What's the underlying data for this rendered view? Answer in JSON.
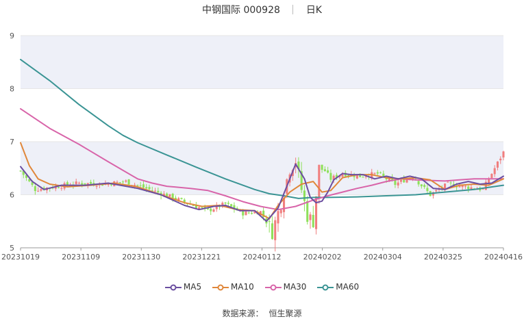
{
  "header": {
    "stock_name": "中钢国际",
    "stock_code": "000928",
    "period": "日K"
  },
  "footer": {
    "source_label": "数据来源：",
    "source_name": "恒生聚源"
  },
  "colors": {
    "up": "#f07e7e",
    "down": "#8fe05b",
    "ma5": "#6b4ea0",
    "ma10": "#e0873a",
    "ma30": "#d864a9",
    "ma60": "#3a9494",
    "band": "#eef0f8"
  },
  "chart_data": {
    "type": "candlestick",
    "ylim": [
      5,
      9
    ],
    "y_ticks": [
      5,
      6,
      7,
      8,
      9
    ],
    "x_ticks": [
      "20231019",
      "20231109",
      "20231130",
      "20231221",
      "20240112",
      "20240202",
      "20240304",
      "20240325",
      "20240416"
    ],
    "legend": [
      "MA5",
      "MA10",
      "MA30",
      "MA60"
    ],
    "legend_position": "bottom",
    "ma_series": [
      {
        "name": "MA5",
        "x": [
          0,
          4,
          8,
          14,
          22,
          30,
          40,
          48,
          56,
          61,
          66,
          70,
          75,
          80,
          84,
          88,
          92,
          94,
          97,
          99,
          101,
          103,
          105,
          107,
          110,
          113,
          117,
          121,
          125,
          129,
          133,
          137,
          141,
          145,
          149,
          153,
          157,
          161,
          165
        ],
        "values": [
          6.53,
          6.25,
          6.1,
          6.18,
          6.18,
          6.22,
          6.12,
          6.0,
          5.8,
          5.72,
          5.78,
          5.8,
          5.7,
          5.7,
          5.5,
          5.75,
          6.3,
          6.58,
          6.3,
          5.95,
          5.85,
          5.88,
          6.05,
          6.28,
          6.4,
          6.38,
          6.38,
          6.3,
          6.35,
          6.3,
          6.35,
          6.3,
          6.12,
          6.1,
          6.2,
          6.25,
          6.2,
          6.22,
          6.35
        ]
      },
      {
        "name": "MA10",
        "x": [
          0,
          3,
          6,
          10,
          16,
          24,
          32,
          40,
          48,
          56,
          62,
          68,
          74,
          80,
          85,
          88,
          92,
          96,
          100,
          103,
          106,
          110,
          115,
          120,
          125,
          130,
          135,
          140,
          145,
          150,
          155,
          160,
          165
        ],
        "values": [
          6.98,
          6.55,
          6.3,
          6.2,
          6.15,
          6.18,
          6.22,
          6.15,
          6.0,
          5.85,
          5.78,
          5.8,
          5.72,
          5.7,
          5.55,
          5.8,
          6.05,
          6.2,
          6.25,
          6.05,
          6.08,
          6.32,
          6.38,
          6.38,
          6.32,
          6.3,
          6.32,
          6.28,
          6.1,
          6.18,
          6.2,
          6.18,
          6.3
        ]
      },
      {
        "name": "MA30",
        "x": [
          0,
          10,
          20,
          30,
          40,
          45,
          50,
          58,
          64,
          70,
          76,
          82,
          88,
          94,
          100,
          105,
          110,
          115,
          120,
          125,
          130,
          135,
          140,
          145,
          150,
          155,
          160,
          165
        ],
        "values": [
          7.62,
          7.25,
          6.95,
          6.62,
          6.3,
          6.22,
          6.16,
          6.12,
          6.08,
          5.98,
          5.87,
          5.78,
          5.72,
          5.78,
          5.9,
          5.98,
          6.05,
          6.12,
          6.18,
          6.25,
          6.3,
          6.28,
          6.27,
          6.26,
          6.28,
          6.3,
          6.3,
          6.3
        ]
      },
      {
        "name": "MA60",
        "x": [
          0,
          10,
          20,
          30,
          35,
          40,
          50,
          60,
          70,
          80,
          85,
          90,
          95,
          100,
          105,
          115,
          125,
          135,
          145,
          155,
          165
        ],
        "values": [
          8.55,
          8.15,
          7.7,
          7.3,
          7.12,
          6.98,
          6.75,
          6.52,
          6.3,
          6.1,
          6.02,
          5.98,
          5.93,
          5.95,
          5.95,
          5.96,
          5.98,
          6.0,
          6.05,
          6.1,
          6.18
        ]
      }
    ],
    "candles_count": 166,
    "candle_anchor_x": [
      0,
      5,
      12,
      20,
      28,
      36,
      44,
      52,
      58,
      64,
      70,
      76,
      82,
      86,
      89,
      92,
      94,
      96,
      98,
      100,
      102,
      104,
      106,
      110,
      116,
      122,
      128,
      134,
      140,
      146,
      152,
      158,
      163,
      165
    ],
    "candle_anchor_close": [
      6.45,
      6.1,
      6.15,
      6.22,
      6.2,
      6.25,
      6.1,
      5.95,
      5.82,
      5.7,
      5.83,
      5.65,
      5.68,
      5.3,
      5.85,
      6.5,
      6.65,
      6.1,
      5.6,
      5.5,
      6.5,
      6.45,
      6.3,
      6.4,
      6.35,
      6.4,
      6.2,
      6.35,
      6.0,
      6.2,
      6.15,
      6.1,
      6.6,
      6.8
    ]
  }
}
